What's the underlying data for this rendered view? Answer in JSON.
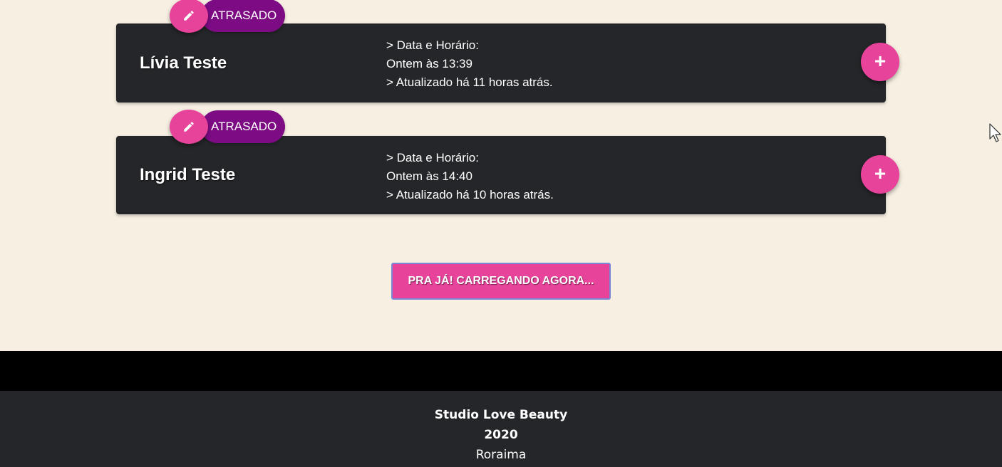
{
  "appointments": [
    {
      "client_name": "Lívia Teste",
      "status": "ATRASADO",
      "datetime_label": "> Data e Horário:",
      "datetime_value": "Ontem às 13:39",
      "updated": "> Atualizado há 11 horas atrás.",
      "add_label": "+"
    },
    {
      "client_name": "Ingrid Teste",
      "status": "ATRASADO",
      "datetime_label": "> Data e Horário:",
      "datetime_value": "Ontem às 14:40",
      "updated": "> Atualizado há 10 horas atrás.",
      "add_label": "+"
    }
  ],
  "load_more": {
    "label": "PRA JÁ! CARREGANDO AGORA..."
  },
  "footer": {
    "brand": "Studio Love Beauty",
    "year": "2020",
    "location": "Roraima"
  },
  "icons": {
    "edit": "pencil-icon",
    "add": "plus-icon",
    "cursor": "mouse-pointer-icon"
  },
  "colors": {
    "background": "#f6efe2",
    "card": "#252629",
    "accent_pink": "#e8439a",
    "status_purple": "#7d0b84",
    "footer_band": "#000000"
  }
}
